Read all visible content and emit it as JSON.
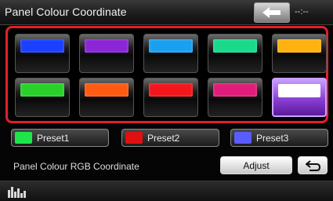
{
  "title": "Panel Colour Coordinate",
  "clock": "--:--",
  "icons": {
    "back": "back-arrow-icon",
    "return": "return-arrow-icon",
    "menu": "equalizer-bars-icon"
  },
  "colour_grid": [
    {
      "color": "#1a3fff",
      "selected": false
    },
    {
      "color": "#8a25d8",
      "selected": false
    },
    {
      "color": "#1aa0f0",
      "selected": false
    },
    {
      "color": "#19d98a",
      "selected": false
    },
    {
      "color": "#ffb10f",
      "selected": false
    },
    {
      "color": "#2ad12a",
      "selected": false
    },
    {
      "color": "#ff5a12",
      "selected": false
    },
    {
      "color": "#f3161a",
      "selected": false
    },
    {
      "color": "#e01d7a",
      "selected": false
    },
    {
      "color": "#ffffff",
      "selected": true
    }
  ],
  "presets": [
    {
      "label": "Preset1",
      "color": "#1ee64a"
    },
    {
      "label": "Preset2",
      "color": "#e01010"
    },
    {
      "label": "Preset3",
      "color": "#5a5cff"
    }
  ],
  "rgb": {
    "label": "Panel Colour RGB Coordinate",
    "adjust_label": "Adjust"
  },
  "colors": {
    "grid_frame": "#e0202a",
    "selected_highlight": "#8b3fd6"
  }
}
